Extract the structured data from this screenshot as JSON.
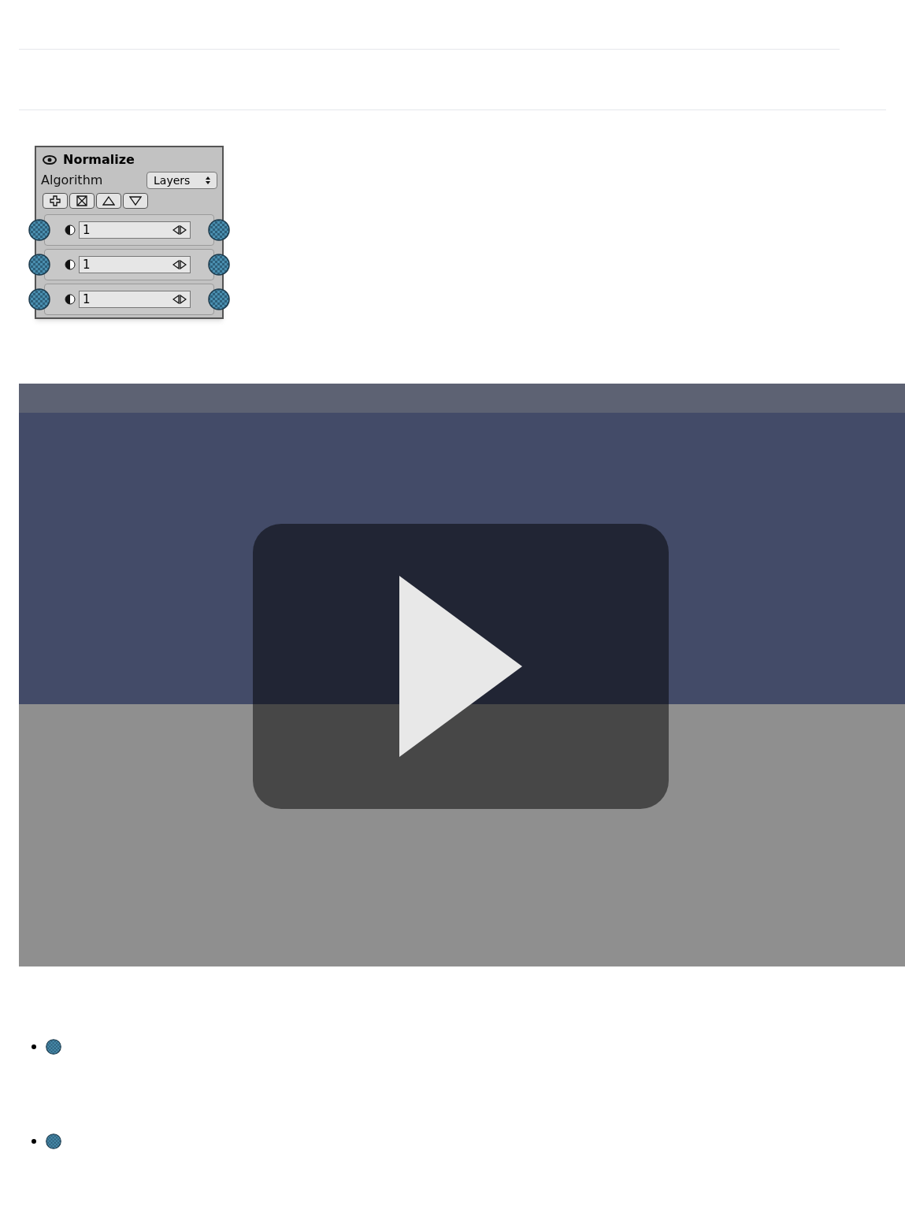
{
  "node": {
    "title": "Normalize",
    "algorithm_label": "Algorithm",
    "algorithm_value": "Layers",
    "layers": [
      {
        "value": "1"
      },
      {
        "value": "1"
      },
      {
        "value": "1"
      }
    ]
  },
  "bullets": [
    {
      "kind": "port"
    },
    {
      "kind": "port"
    }
  ]
}
